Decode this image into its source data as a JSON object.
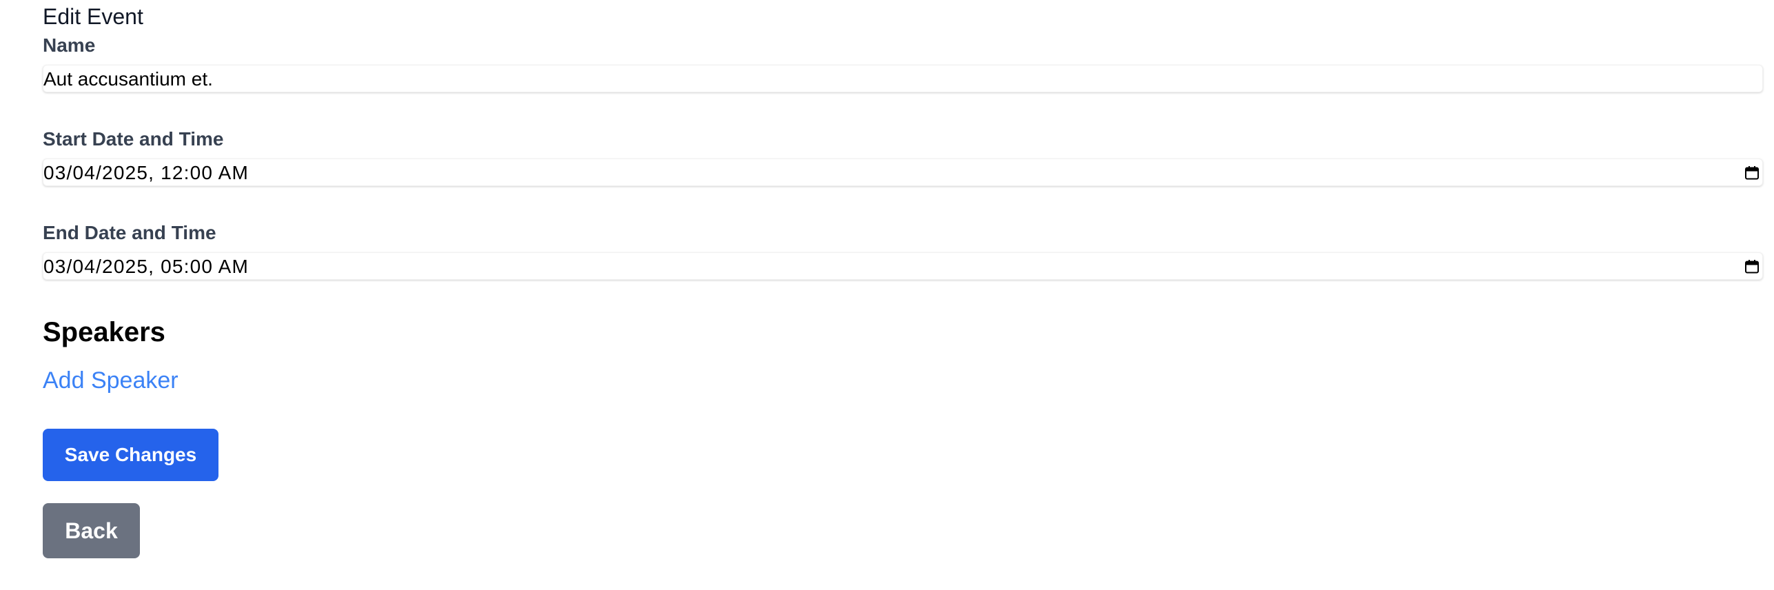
{
  "page": {
    "title": "Edit Event"
  },
  "form": {
    "name": {
      "label": "Name",
      "value": "Aut accusantium et."
    },
    "start": {
      "label": "Start Date and Time",
      "value": "03/04/2025, 12:00 AM"
    },
    "end": {
      "label": "End Date and Time",
      "value": "03/04/2025, 05:00 AM"
    }
  },
  "speakers": {
    "heading": "Speakers",
    "add_label": "Add Speaker"
  },
  "actions": {
    "save_label": "Save Changes",
    "back_label": "Back"
  },
  "icons": {
    "start_picker": "calendar-icon",
    "end_picker": "calendar-icon"
  },
  "colors": {
    "primary": "#2563eb",
    "secondary": "#6b7280",
    "link": "#3b82f6",
    "label": "#374151"
  }
}
